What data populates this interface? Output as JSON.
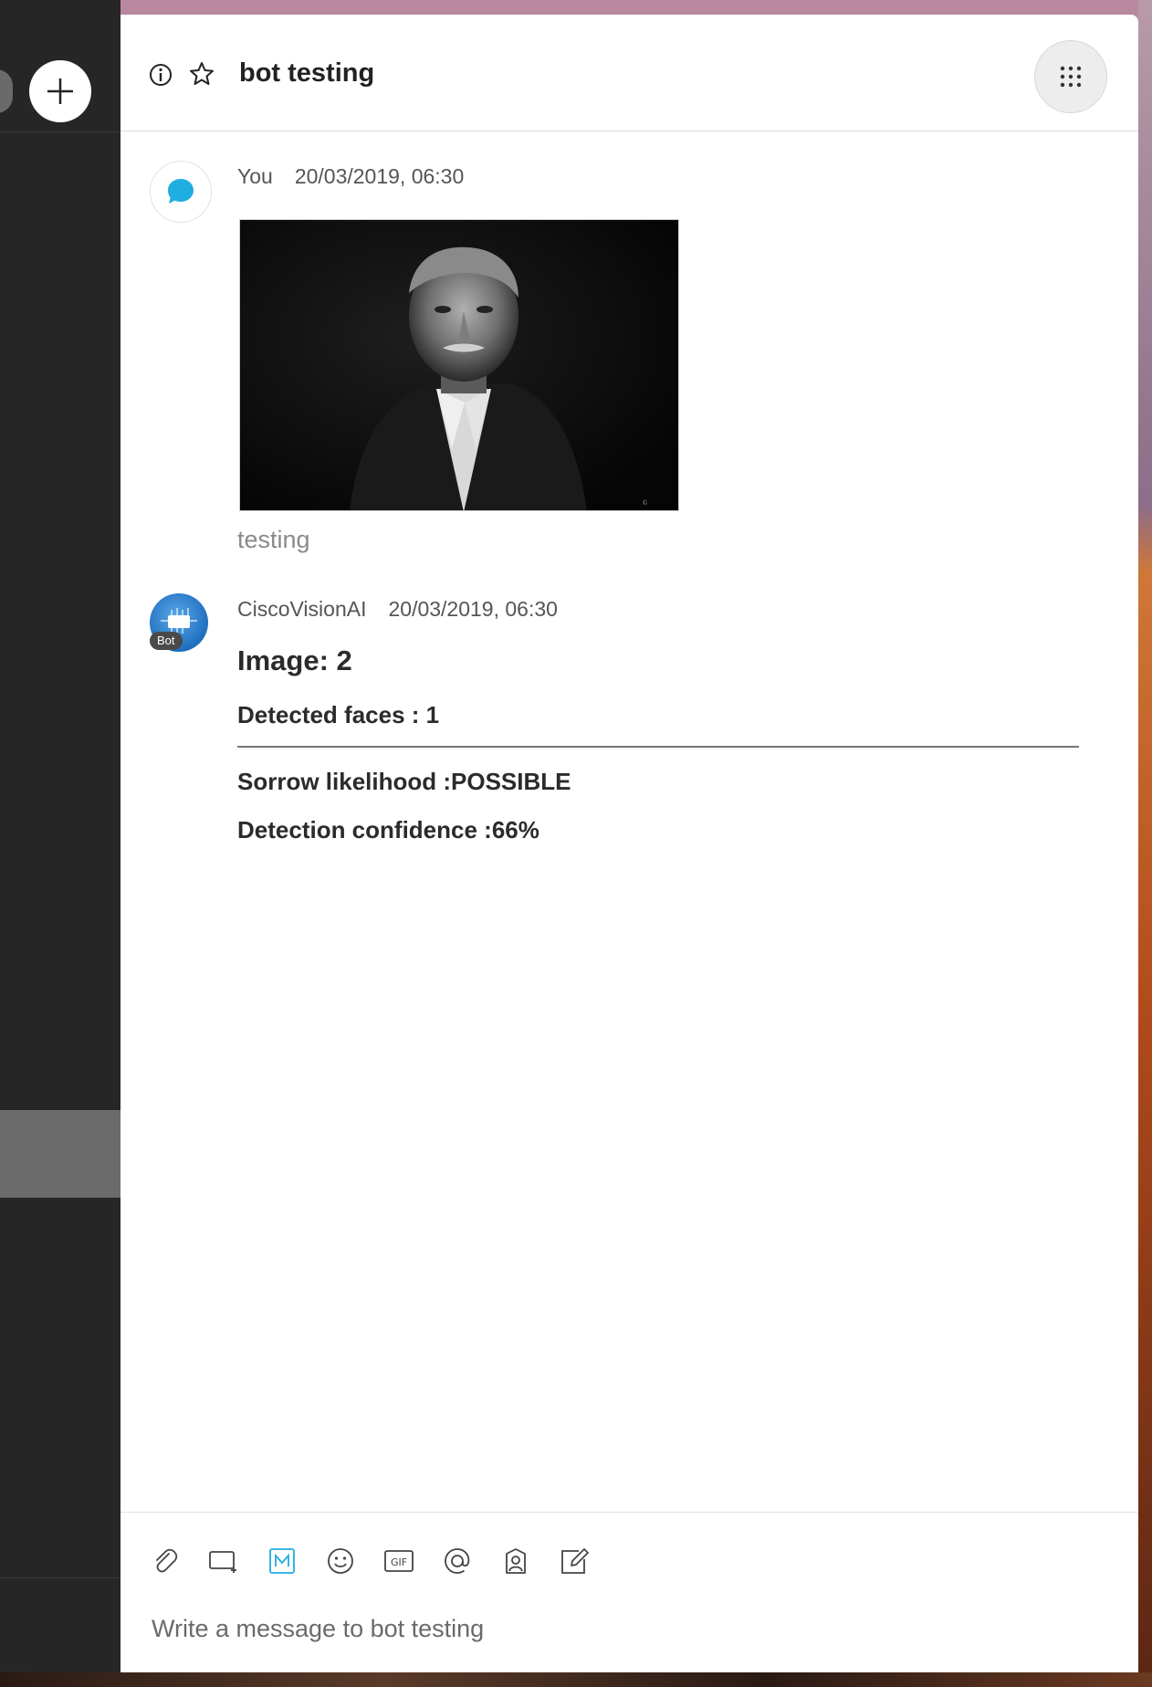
{
  "sidebar": {
    "add_button": "new-space"
  },
  "header": {
    "title": "bot testing"
  },
  "messages": [
    {
      "sender": "You",
      "time": "20/03/2019, 06:30",
      "caption": "testing"
    },
    {
      "sender": "CiscoVisionAI",
      "time": "20/03/2019, 06:30",
      "badge": "Bot",
      "heading": "Image: 2",
      "subheading": "Detected faces : 1",
      "lines": [
        "Sorrow likelihood :POSSIBLE",
        "Detection confidence :66%"
      ]
    }
  ],
  "composer": {
    "placeholder": "Write a message to bot testing",
    "tools": [
      "paperclip-icon",
      "share-screen-icon",
      "markdown-icon",
      "emoji-icon",
      "gif-icon",
      "mention-icon",
      "contact-icon",
      "edit-icon"
    ]
  },
  "colors": {
    "accent": "#1eaee0",
    "sidebar": "#262626"
  }
}
